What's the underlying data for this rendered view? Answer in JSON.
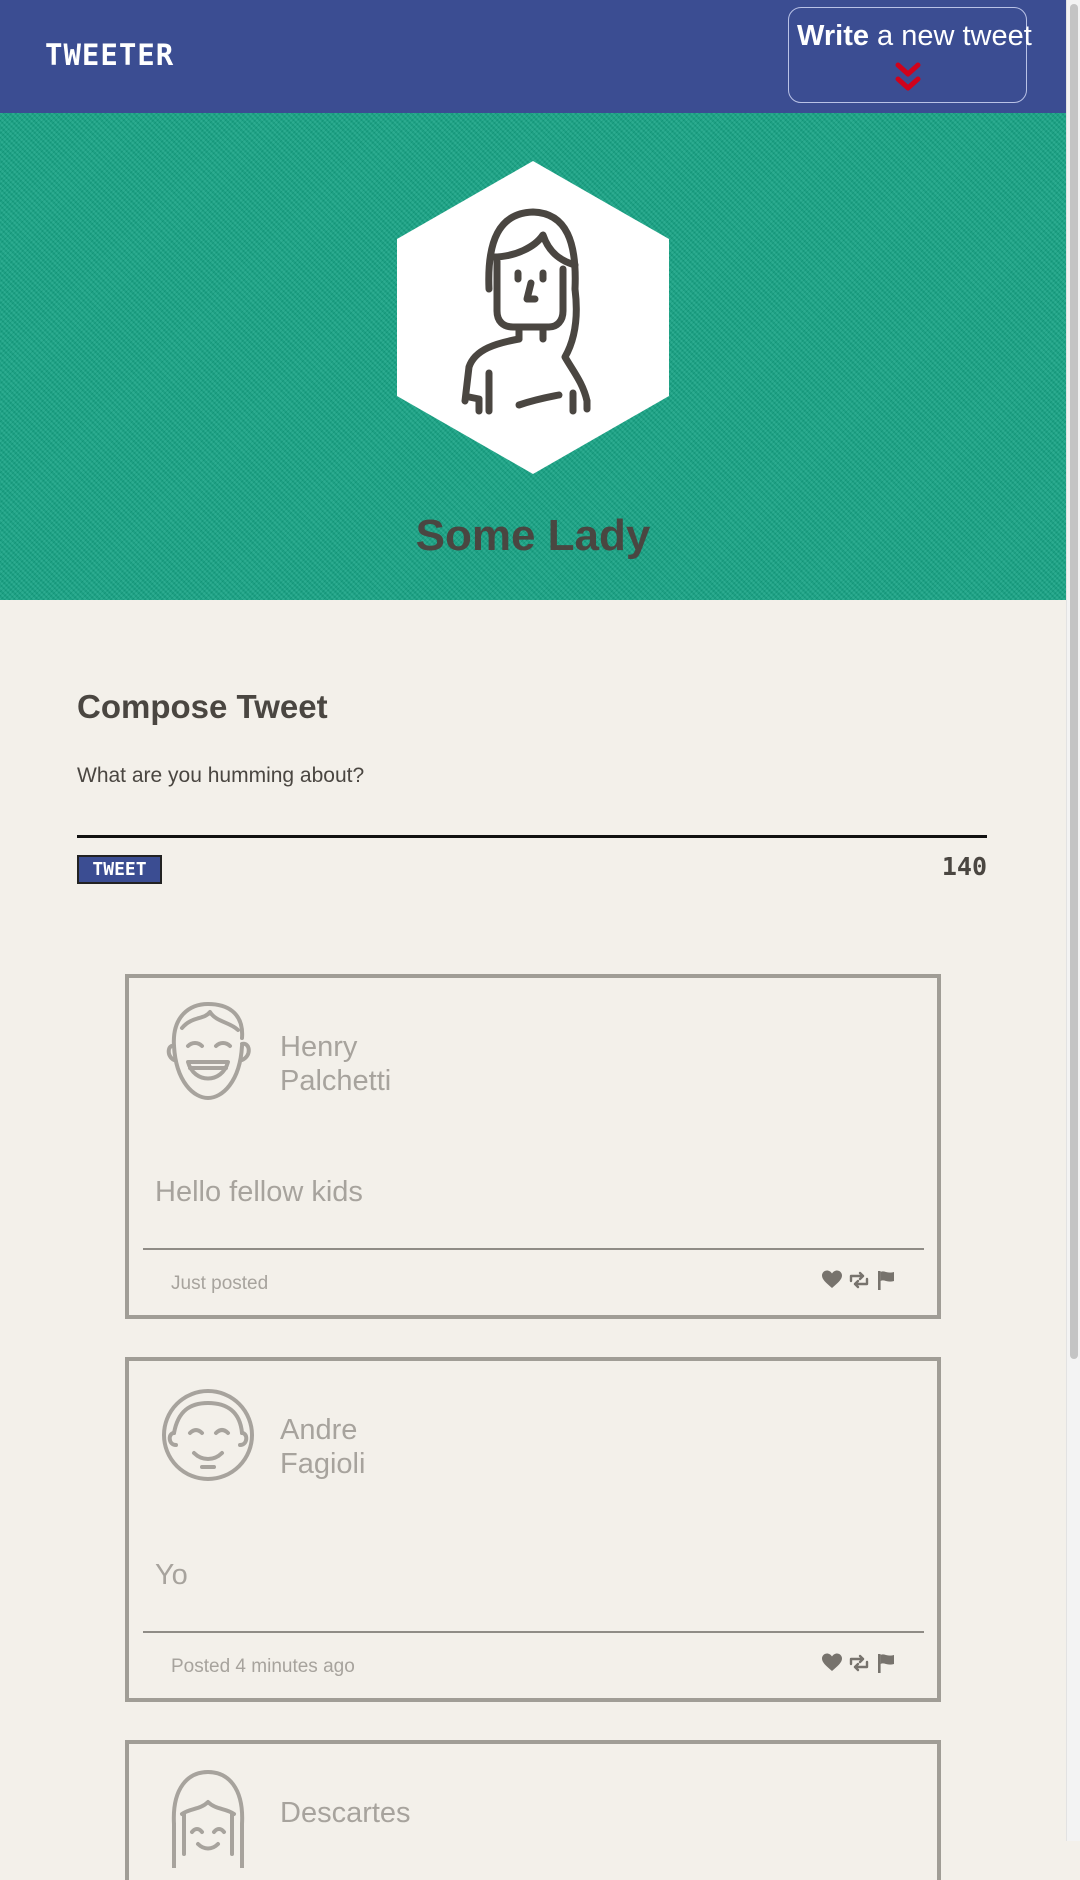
{
  "nav": {
    "brand": "TWEETER",
    "compose_toggle": {
      "bold_word": "Write",
      "rest": "a new tweet",
      "icon": "double-chevron-down-icon",
      "icon_color": "#d0021b"
    }
  },
  "colors": {
    "nav_background": "#3b4d92",
    "profile_background": "#16a384",
    "page_background": "#f3f0ea",
    "text": "#4a4641",
    "tweet_muted_text": "#a7a39d",
    "tweet_border": "#a09d96"
  },
  "profile": {
    "name": "Some Lady",
    "avatar_icon": "woman-avatar-icon"
  },
  "compose": {
    "title": "Compose Tweet",
    "placeholder": "What are you humming about?",
    "button_label": "TWEET",
    "counter": "140"
  },
  "tweets": [
    {
      "author_first": "Henry",
      "author_last": "Palchetti",
      "avatar_icon": "smiling-man-avatar-icon",
      "body": "Hello fellow kids",
      "time": "Just posted",
      "actions": [
        "heart-icon",
        "retweet-icon",
        "flag-icon"
      ]
    },
    {
      "author_first": "Andre",
      "author_last": "Fagioli",
      "avatar_icon": "man-avatar-icon",
      "body": "Yo",
      "time": "Posted 4 minutes ago",
      "actions": [
        "heart-icon",
        "retweet-icon",
        "flag-icon"
      ]
    },
    {
      "author_first": "Descartes",
      "author_last": "",
      "avatar_icon": "bangs-avatar-icon",
      "body": "",
      "time": "",
      "actions": []
    }
  ]
}
